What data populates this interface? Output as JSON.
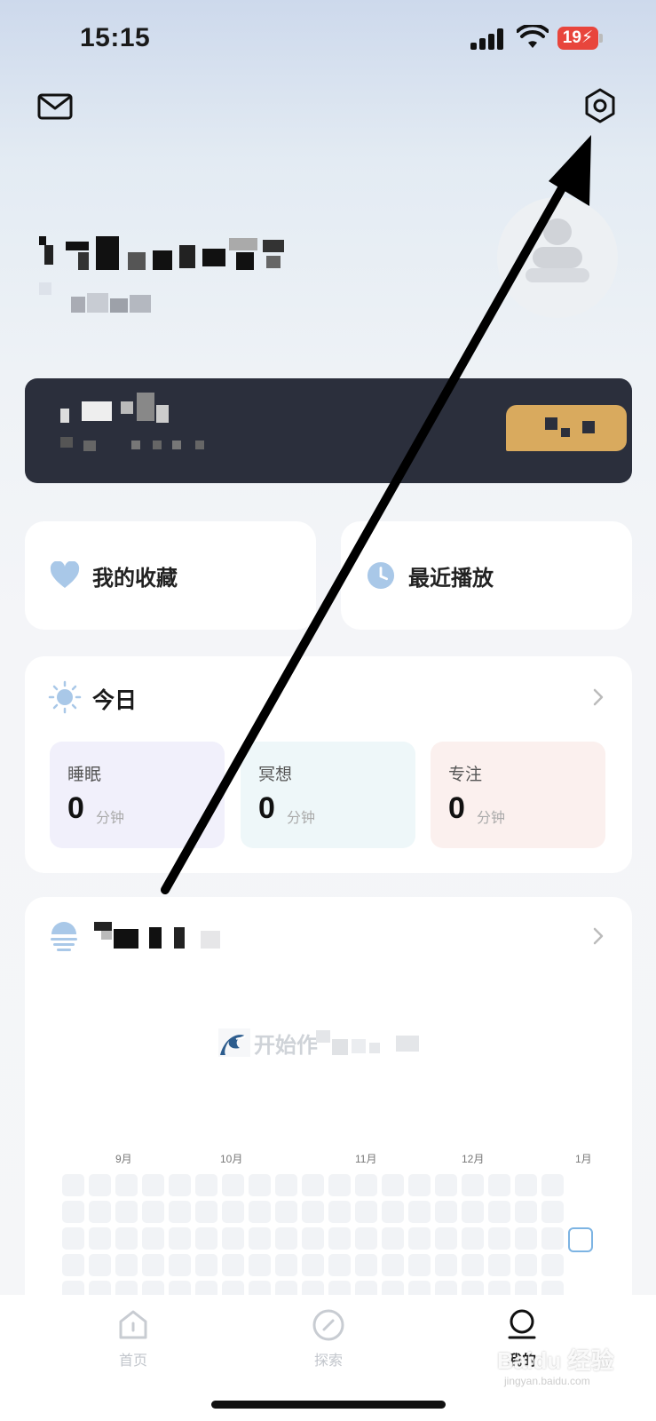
{
  "status_bar": {
    "time": "15:15",
    "battery": "19"
  },
  "header": {
    "mail_icon": "mail-icon",
    "settings_icon": "gear-icon"
  },
  "quick_links": [
    {
      "label": "我的收藏",
      "icon": "heart-icon"
    },
    {
      "label": "最近播放",
      "icon": "clock-icon"
    }
  ],
  "today": {
    "title": "今日",
    "stats": [
      {
        "label": "睡眠",
        "value": "0",
        "unit": "分钟",
        "color": "#f1f0fb"
      },
      {
        "label": "冥想",
        "value": "0",
        "unit": "分钟",
        "color": "#eef7f9"
      },
      {
        "label": "专注",
        "value": "0",
        "unit": "分钟",
        "color": "#fbf0ee"
      }
    ]
  },
  "record": {
    "cta_text": "开始作",
    "months": [
      "9月",
      "10月",
      "11月",
      "12月",
      "1月"
    ]
  },
  "tab_bar": {
    "tabs": [
      {
        "label": "首页",
        "icon": "home-icon",
        "active": false
      },
      {
        "label": "探索",
        "icon": "compass-icon",
        "active": false
      },
      {
        "label": "我的",
        "icon": "profile-icon",
        "active": true
      }
    ]
  },
  "watermark": {
    "text": "Baidu 经验",
    "sub": "jingyan.baidu.com"
  }
}
